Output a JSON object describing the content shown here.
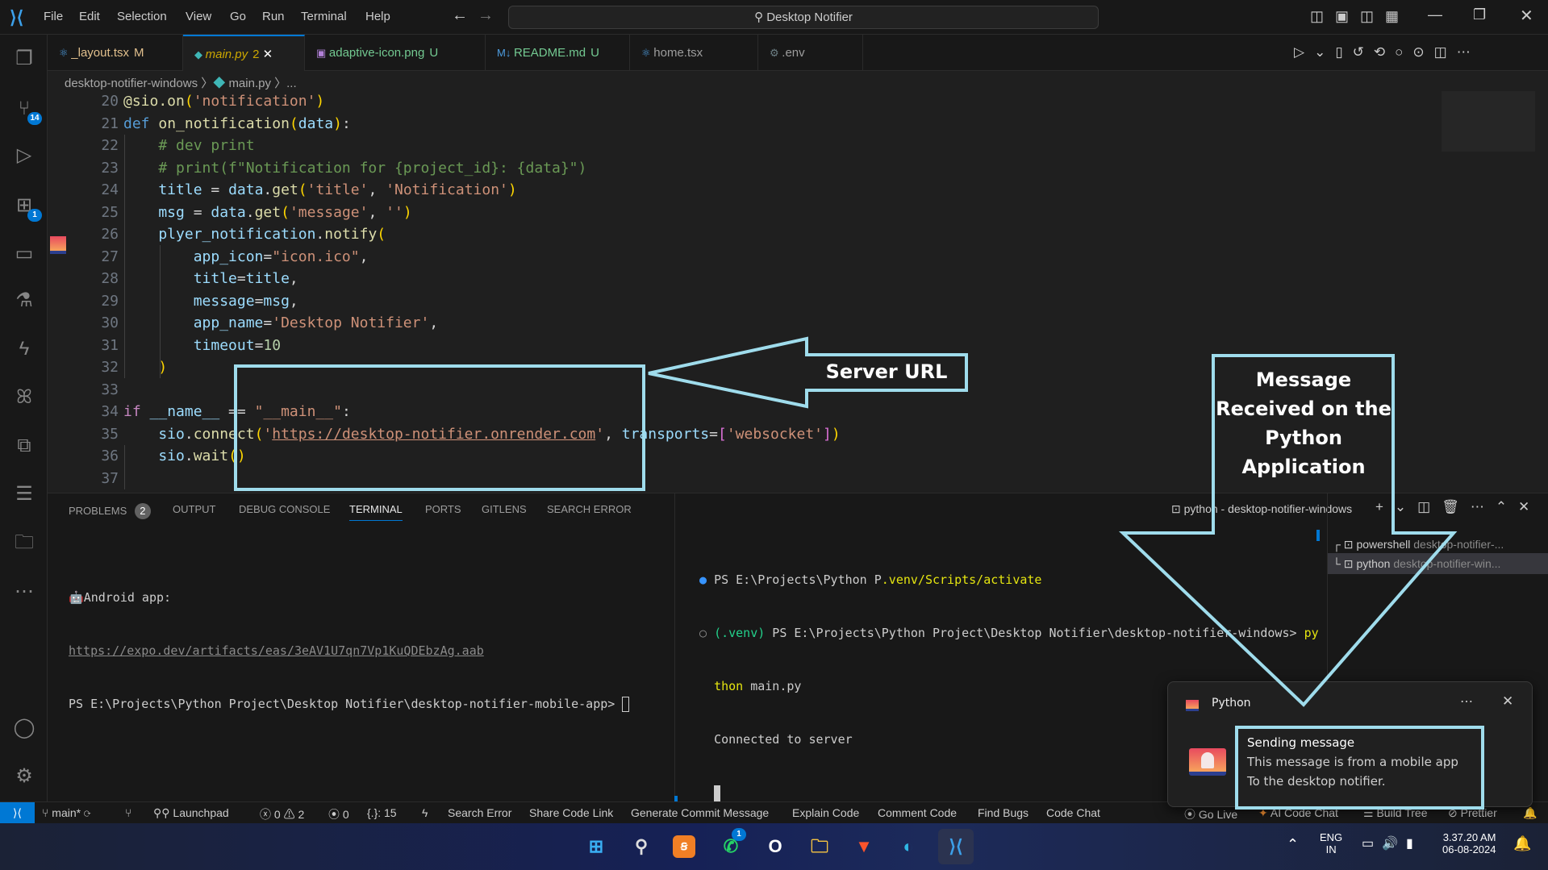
{
  "titlebar": {
    "menu": [
      "File",
      "Edit",
      "Selection",
      "View",
      "Go",
      "Run",
      "Terminal",
      "Help"
    ],
    "search": "Desktop Notifier"
  },
  "tabs": [
    {
      "label": "_layout.tsx",
      "status": "M",
      "icon": "react-icon",
      "color": "#e2c08d"
    },
    {
      "label": "main.py",
      "status": "2",
      "icon": "python-icon",
      "color": "#cca700",
      "active": true
    },
    {
      "label": "adaptive-icon.png",
      "status": "U",
      "icon": "image-icon",
      "color": "#73c991"
    },
    {
      "label": "README.md",
      "status": "U",
      "icon": "markdown-icon",
      "color": "#73c991"
    },
    {
      "label": "home.tsx",
      "status": "",
      "icon": "react-icon",
      "color": "#9d9d9d"
    },
    {
      "label": ".env",
      "status": "",
      "icon": "gear-icon",
      "color": "#9d9d9d"
    }
  ],
  "breadcrumb": [
    "desktop-notifier-windows",
    "main.py",
    "..."
  ],
  "activity": {
    "scm_badge": "14",
    "extensions_badge": "1"
  },
  "code": [
    {
      "n": "20",
      "t": [
        [
          "@sio.on",
          "fn"
        ],
        [
          "(",
          "b1"
        ],
        [
          "'notification'",
          "str"
        ],
        [
          ")",
          "b1"
        ]
      ]
    },
    {
      "n": "21",
      "t": [
        [
          "def ",
          "kw"
        ],
        [
          "on_notification",
          "fn"
        ],
        [
          "(",
          "b1"
        ],
        [
          "data",
          "var"
        ],
        [
          ")",
          "b1"
        ],
        [
          ":",
          "pl"
        ]
      ]
    },
    {
      "n": "22",
      "t": [
        [
          "    # dev print",
          "cm"
        ]
      ]
    },
    {
      "n": "23",
      "t": [
        [
          "    # print(f\"Notification for {project_id}: {data}\")",
          "cm"
        ]
      ]
    },
    {
      "n": "24",
      "t": [
        [
          "    title",
          "var"
        ],
        [
          " = ",
          "pl"
        ],
        [
          "data",
          "var"
        ],
        [
          ".",
          "pl"
        ],
        [
          "get",
          "fn"
        ],
        [
          "(",
          "b1"
        ],
        [
          "'title'",
          "str"
        ],
        [
          ", ",
          "pl"
        ],
        [
          "'Notification'",
          "str"
        ],
        [
          ")",
          "b1"
        ]
      ]
    },
    {
      "n": "25",
      "t": [
        [
          "    msg",
          "var"
        ],
        [
          " = ",
          "pl"
        ],
        [
          "data",
          "var"
        ],
        [
          ".",
          "pl"
        ],
        [
          "get",
          "fn"
        ],
        [
          "(",
          "b1"
        ],
        [
          "'message'",
          "str"
        ],
        [
          ", ",
          "pl"
        ],
        [
          "''",
          "str"
        ],
        [
          ")",
          "b1"
        ]
      ]
    },
    {
      "n": "26",
      "t": [
        [
          "    plyer_notification",
          "var"
        ],
        [
          ".",
          "pl"
        ],
        [
          "notify",
          "fn"
        ],
        [
          "(",
          "b1"
        ]
      ]
    },
    {
      "n": "27",
      "t": [
        [
          "        app_icon",
          "var"
        ],
        [
          "=",
          "pl"
        ],
        [
          "\"icon.ico\"",
          "str"
        ],
        [
          ",",
          "pl"
        ]
      ]
    },
    {
      "n": "28",
      "t": [
        [
          "        title",
          "var"
        ],
        [
          "=",
          "pl"
        ],
        [
          "title",
          "var"
        ],
        [
          ",",
          "pl"
        ]
      ]
    },
    {
      "n": "29",
      "t": [
        [
          "        message",
          "var"
        ],
        [
          "=",
          "pl"
        ],
        [
          "msg",
          "var"
        ],
        [
          ",",
          "pl"
        ]
      ]
    },
    {
      "n": "30",
      "t": [
        [
          "        app_name",
          "var"
        ],
        [
          "=",
          "pl"
        ],
        [
          "'Desktop Notifier'",
          "str"
        ],
        [
          ",",
          "pl"
        ]
      ]
    },
    {
      "n": "31",
      "t": [
        [
          "        timeout",
          "var"
        ],
        [
          "=",
          "pl"
        ],
        [
          "10",
          "num"
        ]
      ]
    },
    {
      "n": "32",
      "t": [
        [
          "    )",
          "b1"
        ]
      ]
    },
    {
      "n": "33",
      "t": []
    },
    {
      "n": "34",
      "t": [
        [
          "if ",
          "ctl"
        ],
        [
          "__name__",
          "var"
        ],
        [
          " == ",
          "pl"
        ],
        [
          "\"__main__\"",
          "str"
        ],
        [
          ":",
          "pl"
        ]
      ]
    },
    {
      "n": "35",
      "t": [
        [
          "    sio",
          "var"
        ],
        [
          ".",
          "pl"
        ],
        [
          "connect",
          "fn"
        ],
        [
          "(",
          "b1"
        ],
        [
          "'",
          "str"
        ],
        [
          "https://desktop-notifier.onrender.com",
          "url"
        ],
        [
          "'",
          "str"
        ],
        [
          ", ",
          "pl"
        ],
        [
          "transports",
          "var"
        ],
        [
          "=",
          "pl"
        ],
        [
          "[",
          "b2"
        ],
        [
          "'websocket'",
          "str"
        ],
        [
          "]",
          "b2"
        ],
        [
          ")",
          "b1"
        ]
      ]
    },
    {
      "n": "36",
      "t": [
        [
          "    sio",
          "var"
        ],
        [
          ".",
          "pl"
        ],
        [
          "wait",
          "fn"
        ],
        [
          "(",
          "b1"
        ],
        [
          ")",
          "b1"
        ]
      ]
    },
    {
      "n": "37",
      "t": []
    }
  ],
  "panel": {
    "tabs": [
      "PROBLEMS",
      "OUTPUT",
      "DEBUG CONSOLE",
      "TERMINAL",
      "PORTS",
      "GITLENS",
      "SEARCH ERROR"
    ],
    "problems_count": "2",
    "active_terminal": "python - desktop-notifier-windows"
  },
  "terminal_left": {
    "line1": "Android app:",
    "link": "https://expo.dev/artifacts/eas/3eAV1U7qn7Vp1KuQDEbzAg.aab",
    "prompt": "PS E:\\Projects\\Python Project\\Desktop Notifier\\desktop-notifier-mobile-app> "
  },
  "terminal_right": {
    "l1a": "PS E:\\Projects\\Python P",
    "l1b": ".venv/Scripts/activate",
    "l2a": "(.venv)",
    "l2b": " PS E:\\Projects\\Python Project\\Desktop Notifier\\desktop-notifier-windows> ",
    "l2c": "py",
    "l3a": "thon",
    "l3b": " main.py",
    "l4": "Connected to server"
  },
  "terminal_list": [
    {
      "name": "powershell",
      "cwd": "desktop-notifier-..."
    },
    {
      "name": "python",
      "cwd": "desktop-notifier-win..."
    }
  ],
  "statusbar": {
    "branch": "main*",
    "launchpad": "Launchpad",
    "errors": "0",
    "warnings": "2",
    "ports": "0",
    "braces": "{.}: 15",
    "items": [
      "Search Error",
      "Share Code Link",
      "Generate Commit Message",
      "Explain Code",
      "Comment Code",
      "Find Bugs",
      "Code Chat"
    ],
    "right": [
      "Go Live",
      "AI Code Chat",
      "Build Tree",
      "Prettier"
    ]
  },
  "notification": {
    "app": "Python",
    "title": "Sending message",
    "line1": "This message is from a mobile app",
    "line2": "To the desktop notifier."
  },
  "annotations": {
    "server_url": "Server URL",
    "message": "Message Received on the Python Application",
    "color": "#9fdcec"
  },
  "taskbar": {
    "icons": [
      "windows-start-icon",
      "search-icon",
      "xampp-icon",
      "whatsapp-icon",
      "opera-gx-icon",
      "file-explorer-icon",
      "brave-icon",
      "edge-icon",
      "vscode-icon"
    ],
    "whatsapp_badge": "1",
    "lang1": "ENG",
    "lang2": "IN",
    "time": "3.37.20 AM",
    "date": "06-08-2024"
  }
}
